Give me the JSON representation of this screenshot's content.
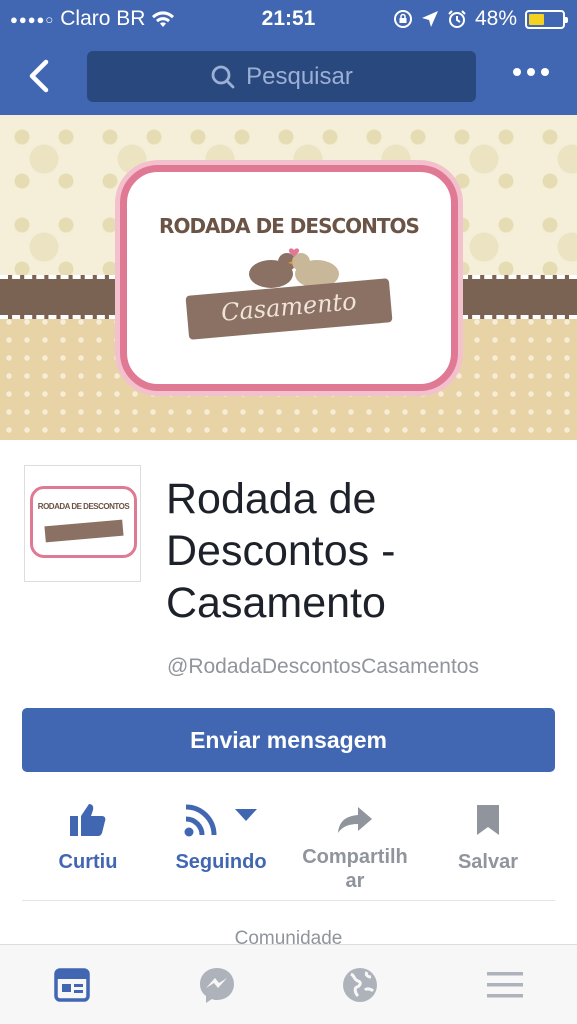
{
  "status_bar": {
    "carrier": "Claro BR",
    "signal_dots": "●●●●○",
    "time": "21:51",
    "battery_percent": "48%",
    "battery_level": 0.48
  },
  "nav": {
    "search_placeholder": "Pesquisar"
  },
  "cover": {
    "label_title": "RODADA DE DESCONTOS",
    "banner_text": "Casamento"
  },
  "profile": {
    "name_lines": [
      "Rodada de",
      "Descontos -",
      "Casamento"
    ],
    "handle": "@RodadaDescontosCasamentos"
  },
  "message_button": "Enviar mensagem",
  "actions": [
    {
      "label": "Curtiu",
      "icon": "like-icon",
      "active": true
    },
    {
      "label": "Seguindo",
      "icon": "rss-icon",
      "active": true
    },
    {
      "label": "Compartilh\nar",
      "icon": "share-icon",
      "active": false
    },
    {
      "label": "Salvar",
      "icon": "bookmark-icon",
      "active": false
    }
  ],
  "section_label": "Comunidade",
  "tabs": [
    {
      "icon": "news-feed-icon",
      "active": true
    },
    {
      "icon": "messenger-icon",
      "active": false
    },
    {
      "icon": "globe-icon",
      "active": false
    },
    {
      "icon": "menu-icon",
      "active": false
    }
  ],
  "colors": {
    "brand": "#4267b2",
    "label_pink": "#e07a94",
    "battery": "#f5d21f"
  }
}
